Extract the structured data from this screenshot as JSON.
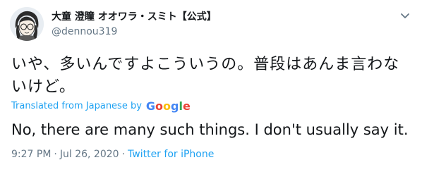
{
  "user": {
    "display_name": "大童 澄瞳 オオワラ・スミト【公式】",
    "handle": "@dennou319"
  },
  "tweet": {
    "text": "いや、多いんですよこういうの。普段はあんま言わないけど。",
    "translated_label": "Translated from Japanese by",
    "translation": "No, there are many such things. I don't usually say it.",
    "time": "9:27 PM",
    "separator": "·",
    "date": "Jul 26, 2020",
    "source": "Twitter for iPhone"
  },
  "google_logo": {
    "letters": [
      "G",
      "o",
      "o",
      "g",
      "l",
      "e"
    ],
    "colors": [
      "#4285f4",
      "#ea4335",
      "#fbbc05",
      "#4285f4",
      "#34a853",
      "#ea4335"
    ]
  },
  "icons": {
    "avatar": "avatar-illustration",
    "menu": "chevron-down-icon"
  },
  "colors": {
    "accent": "#1da1f2",
    "text": "#14171a",
    "muted": "#657786"
  }
}
